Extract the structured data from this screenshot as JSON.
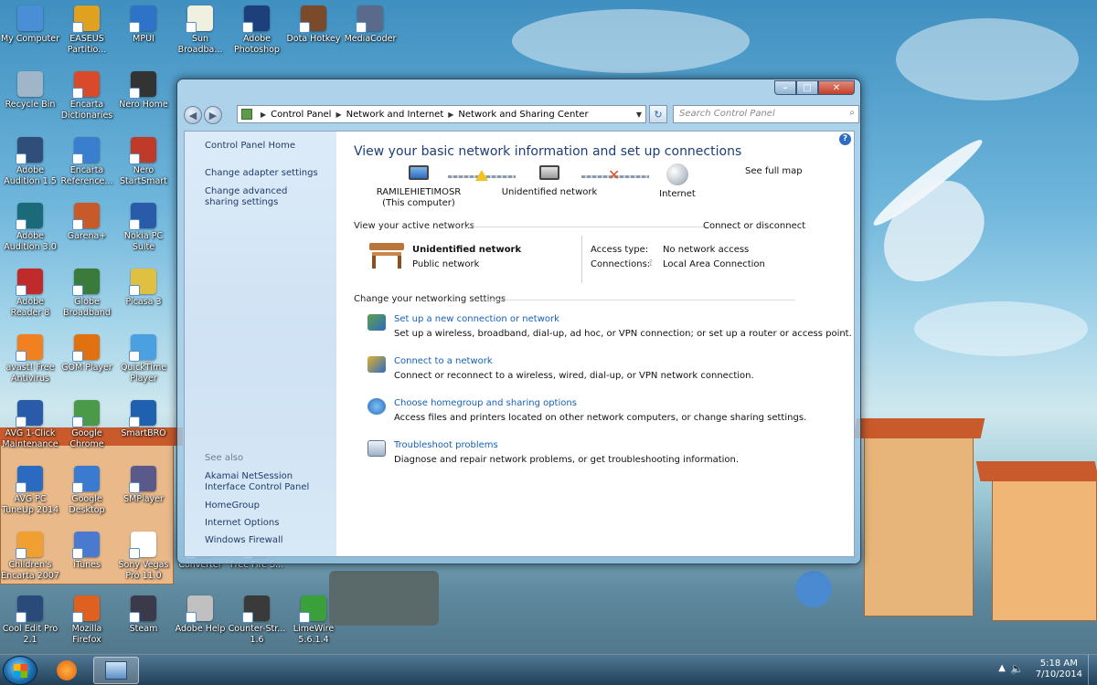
{
  "desktop": {
    "icons": [
      {
        "label": "My Computer",
        "color": "#4a8fd6"
      },
      {
        "label": "EASEUS Partitio...",
        "color": "#e0a020"
      },
      {
        "label": "MPUI",
        "color": "#2f73c8"
      },
      {
        "label": "Sun Broadba...",
        "color": "#f0f0e0"
      },
      {
        "label": "Adobe Photoshop",
        "color": "#1d3f7a"
      },
      {
        "label": "Dota Hotkey",
        "color": "#7a4a2a"
      },
      {
        "label": "MediaCoder",
        "color": "#5a6a8a"
      },
      {
        "label": "Recycle Bin",
        "color": "#9fb6c8"
      },
      {
        "label": "Encarta Dictionaries",
        "color": "#d94a2a"
      },
      {
        "label": "Nero Home",
        "color": "#333333"
      },
      {
        "label": "Adobe Audition 1.5",
        "color": "#2f4f7a"
      },
      {
        "label": "Encarta Reference...",
        "color": "#3a7fcf"
      },
      {
        "label": "Nero StartSmart",
        "color": "#c03a2a"
      },
      {
        "label": "Adobe Audition 3.0",
        "color": "#1a6a7a"
      },
      {
        "label": "Garena+",
        "color": "#c85a2a"
      },
      {
        "label": "Nokia PC Suite",
        "color": "#2a5aaa"
      },
      {
        "label": "Adobe Reader 8",
        "color": "#c02a2a"
      },
      {
        "label": "Globe Broadband",
        "color": "#3a7a3a"
      },
      {
        "label": "Picasa 3",
        "color": "#e0c040"
      },
      {
        "label": "avast! Free Antivirus",
        "color": "#f08020"
      },
      {
        "label": "GOM Player",
        "color": "#e07010"
      },
      {
        "label": "QuickTime Player",
        "color": "#4aa0e0"
      },
      {
        "label": "AVG 1-Click Maintenance",
        "color": "#2a5aaa"
      },
      {
        "label": "Google Chrome",
        "color": "#4a9a4a"
      },
      {
        "label": "SmartBRO",
        "color": "#2060b0"
      },
      {
        "label": "AVG PC TuneUp 2014",
        "color": "#2a6ac0"
      },
      {
        "label": "Google Desktop",
        "color": "#3a7ad0"
      },
      {
        "label": "SMPlayer",
        "color": "#5a5a8a"
      },
      {
        "label": "Children's Encarta 2007",
        "color": "#f0a030"
      },
      {
        "label": "iTunes",
        "color": "#4a7ad0"
      },
      {
        "label": "Sony Vegas Pro 11.0",
        "color": "#ffffff"
      },
      {
        "label": "Converter",
        "color": "#6a8aaa"
      },
      {
        "label": "Free Fire S...",
        "color": "#8a5a3a"
      },
      {
        "label": "Cool Edit Pro 2.1",
        "color": "#2a4a7a"
      },
      {
        "label": "Mozilla Firefox",
        "color": "#e06020"
      },
      {
        "label": "Steam",
        "color": "#3a3a4a"
      },
      {
        "label": "Adobe Help",
        "color": "#c0c0c0"
      },
      {
        "label": "Counter-Str... 1.6",
        "color": "#3a3a3a"
      },
      {
        "label": "LimeWire 5.6.1.4",
        "color": "#3aa03a"
      }
    ]
  },
  "window": {
    "address": {
      "crumbs": [
        "Control Panel",
        "Network and Internet",
        "Network and Sharing Center"
      ]
    },
    "search_placeholder": "Search Control Panel",
    "sidebar": {
      "home": "Control Panel Home",
      "adapter": "Change adapter settings",
      "advanced": "Change advanced sharing settings",
      "see_also": "See also",
      "akamai": "Akamai NetSession Interface Control Panel",
      "homegroup": "HomeGroup",
      "internet_options": "Internet Options",
      "firewall": "Windows Firewall"
    },
    "main": {
      "title": "View your basic network information and set up connections",
      "see_full_map": "See full map",
      "map": {
        "computer_name": "RAMILEHIETIMOSR",
        "computer_sub": "(This computer)",
        "network": "Unidentified network",
        "internet": "Internet"
      },
      "active_header": "View your active networks",
      "connect_disconnect": "Connect or disconnect",
      "active": {
        "name": "Unidentified network",
        "type": "Public network",
        "access_label": "Access type:",
        "access_value": "No network access",
        "conn_label": "Connections:",
        "conn_value": "Local Area Connection"
      },
      "settings_header": "Change your networking settings",
      "tasks": [
        {
          "title": "Set up a new connection or network",
          "desc": "Set up a wireless, broadband, dial-up, ad hoc, or VPN connection; or set up a router or access point."
        },
        {
          "title": "Connect to a network",
          "desc": "Connect or reconnect to a wireless, wired, dial-up, or VPN network connection."
        },
        {
          "title": "Choose homegroup and sharing options",
          "desc": "Access files and printers located on other network computers, or change sharing settings."
        },
        {
          "title": "Troubleshoot problems",
          "desc": "Diagnose and repair network problems, or get troubleshooting information."
        }
      ]
    }
  },
  "taskbar": {
    "time": "5:18 AM",
    "date": "7/10/2014"
  }
}
